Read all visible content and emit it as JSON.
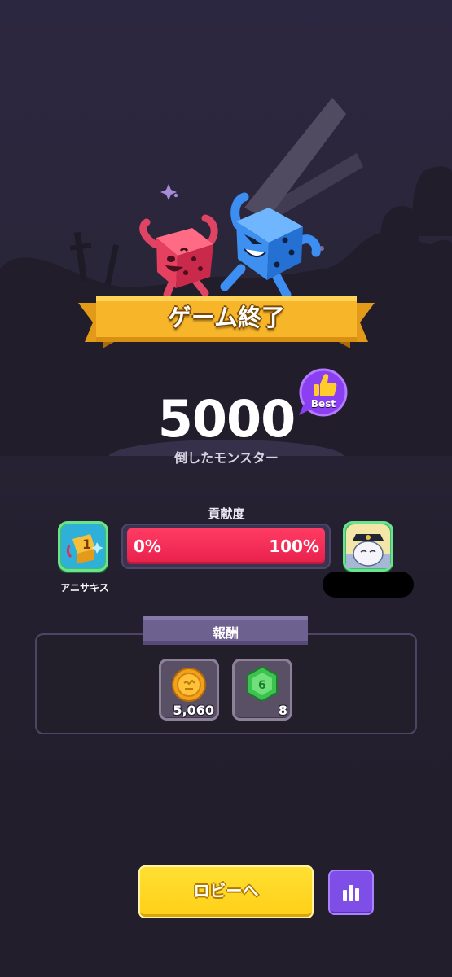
{
  "banner": {
    "title": "ゲーム終了"
  },
  "result": {
    "score": "5000",
    "score_label": "倒したモンスター",
    "badge_label": "Best"
  },
  "contribution": {
    "title": "貢献度",
    "left_percent": "0%",
    "right_percent": "100%",
    "player_left_name": "アニサキス"
  },
  "rewards": {
    "title": "報酬",
    "items": [
      {
        "icon": "coin-icon",
        "amount": "5,060"
      },
      {
        "icon": "gem-icon",
        "amount": "8"
      }
    ]
  },
  "actions": {
    "lobby_label": "ロビーへ",
    "stats_icon": "bar-chart-icon"
  },
  "colors": {
    "background": "#2a2538",
    "banner": "#f5b623",
    "bar_fill": "#f0294f",
    "lobby_button": "#ffd21f",
    "stats_button": "#7e4ee6"
  }
}
